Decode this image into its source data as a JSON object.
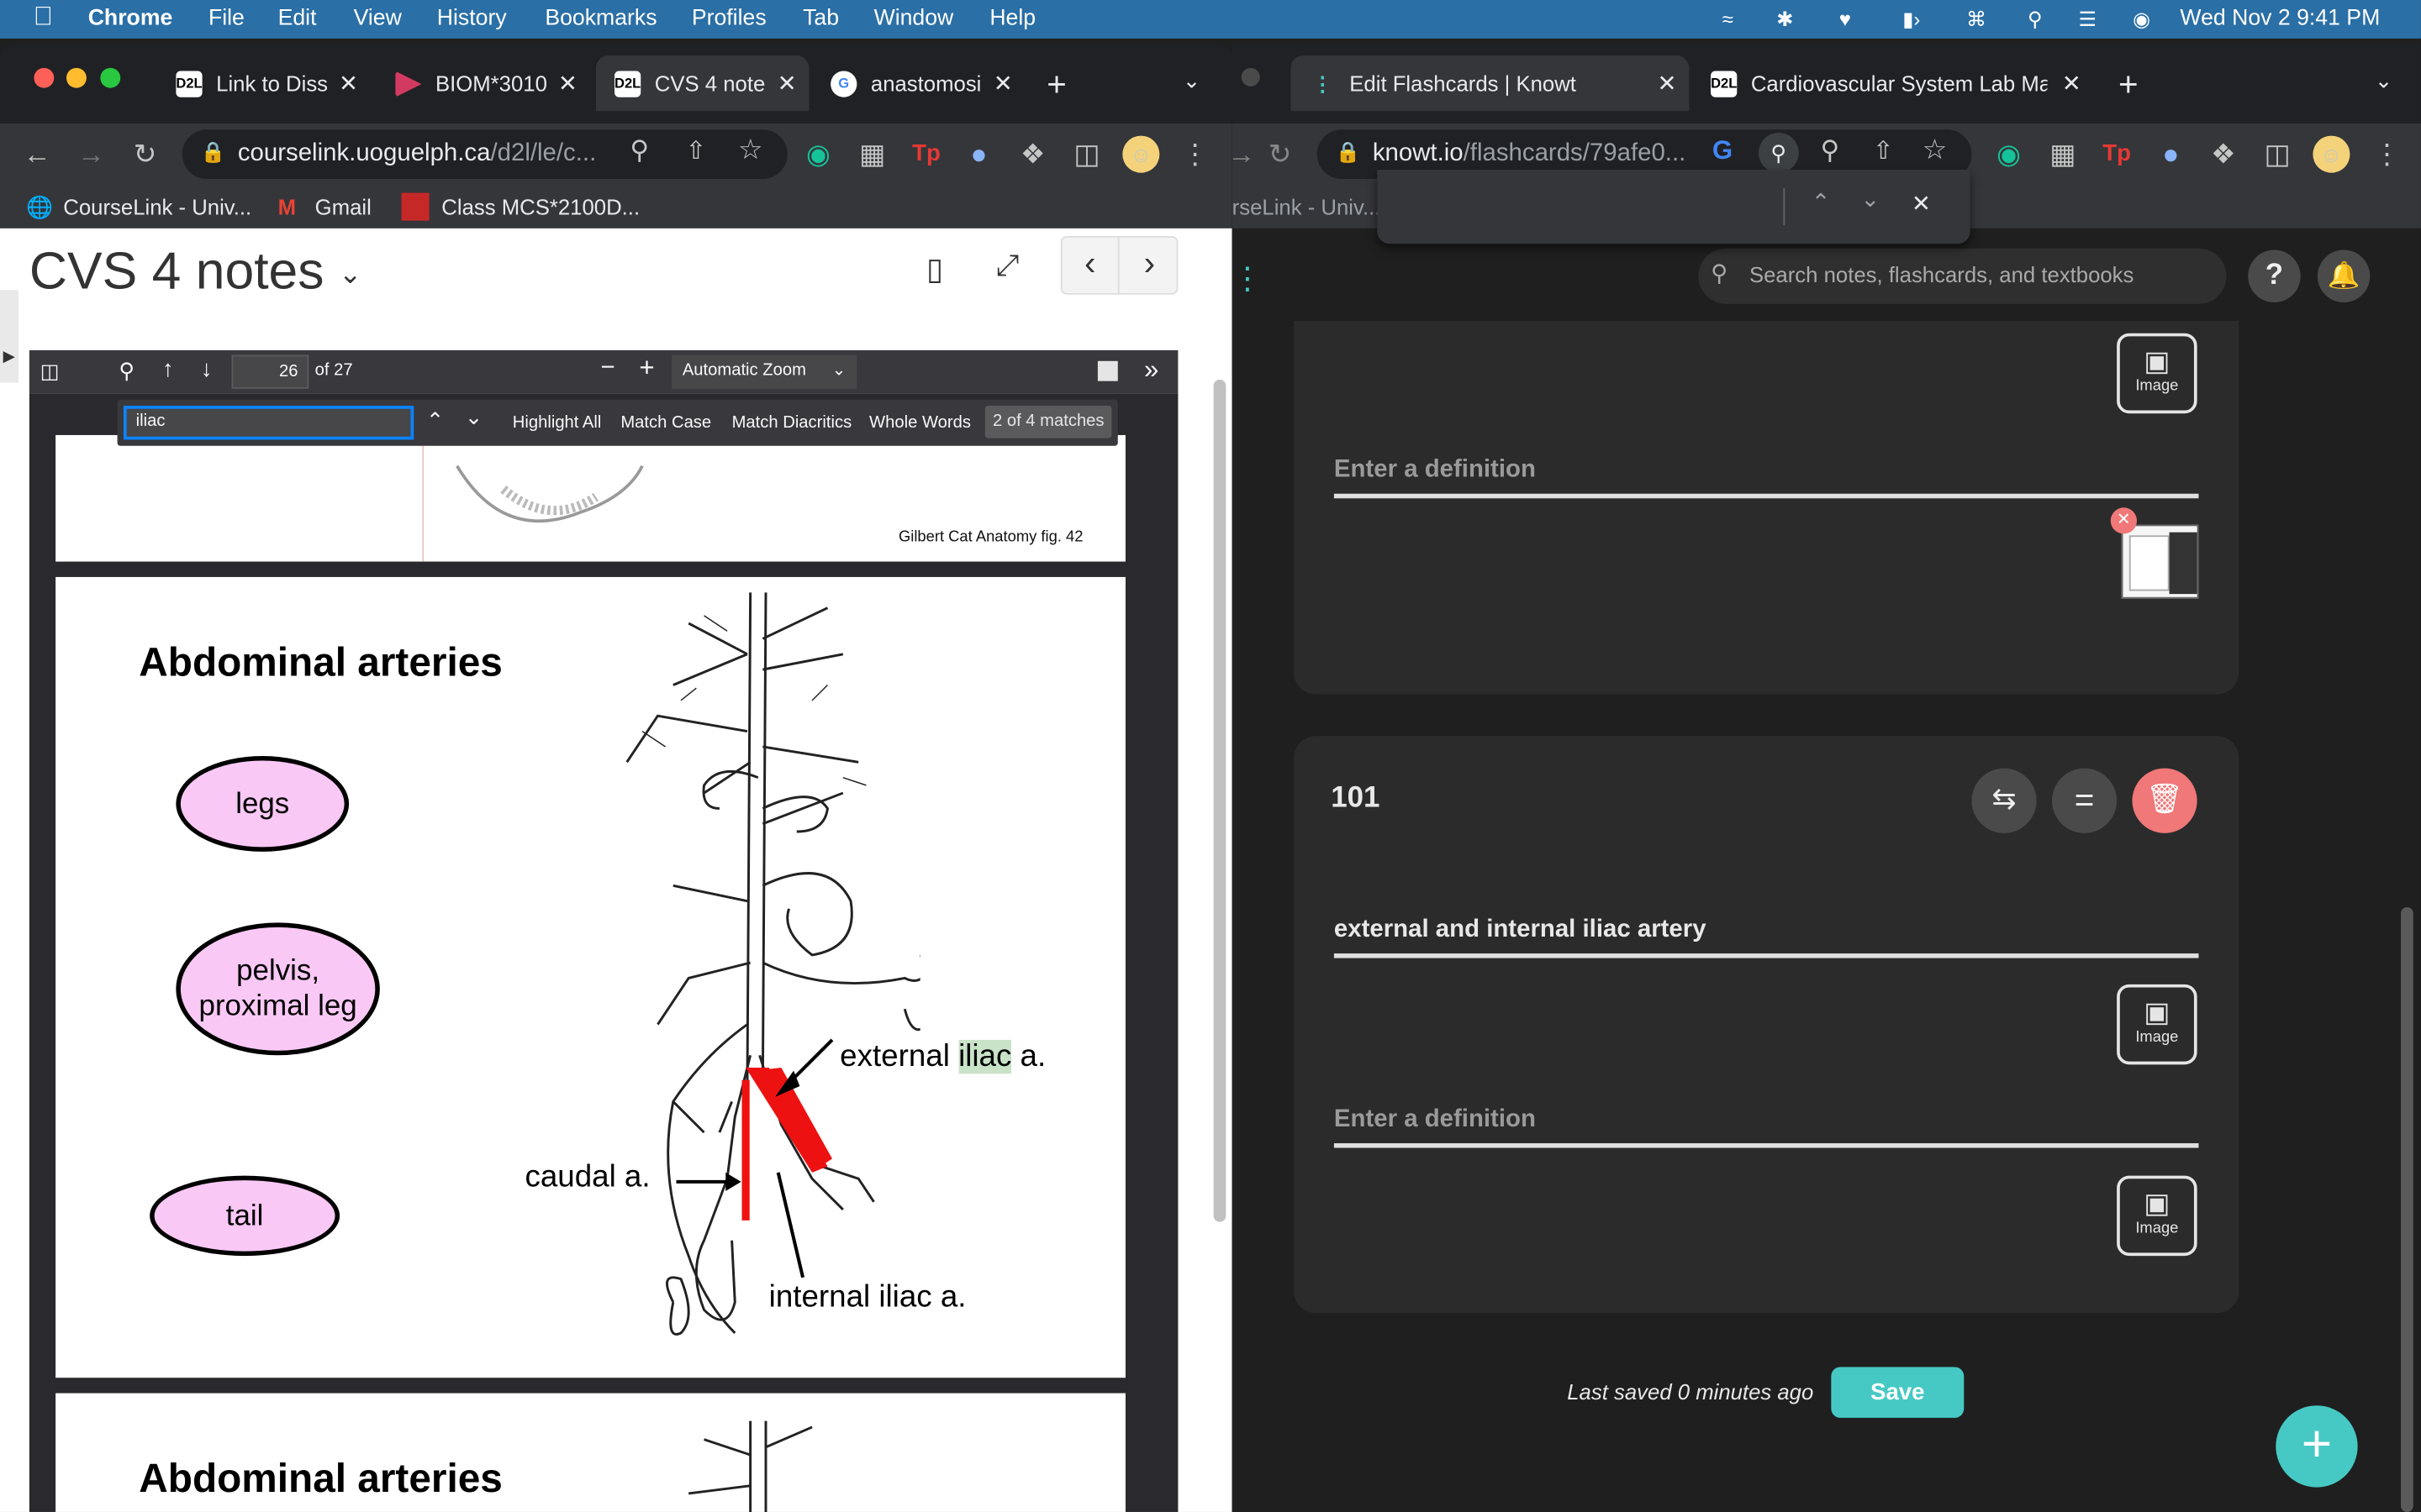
{
  "menubar": {
    "app": "Chrome",
    "items": [
      "File",
      "Edit",
      "View",
      "History",
      "Bookmarks",
      "Profiles",
      "Tab",
      "Window",
      "Help"
    ],
    "clock": "Wed Nov 2  9:41 PM"
  },
  "left_window": {
    "tabs": [
      {
        "label": "Link to Diss",
        "fav": "D2L"
      },
      {
        "label": "BIOM*3010",
        "fav": ""
      },
      {
        "label": "CVS 4 note",
        "fav": "D2L"
      },
      {
        "label": "anastomosi",
        "fav": "G"
      }
    ],
    "url_host": "courselink.uoguelph.ca",
    "url_path": "/d2l/le/c...",
    "bookmarks": [
      "CourseLink - Univ...",
      "Gmail",
      "Class MCS*2100D..."
    ],
    "doc_title": "CVS 4 notes",
    "pdf": {
      "page": "26",
      "of": "of 27",
      "zoom": "Automatic Zoom"
    },
    "find": {
      "query": "iliac",
      "highlight_all": "Highlight All",
      "match_case": "Match Case",
      "match_diacritics": "Match Diacritics",
      "whole_words": "Whole Words",
      "status": "2 of 4 matches"
    },
    "page_top_caption": "Gilbert Cat Anatomy fig. 42",
    "slide": {
      "title": "Abdominal arteries",
      "ovals": [
        "legs",
        "pelvis,\nproximal leg",
        "tail"
      ],
      "labels": {
        "external": "external ",
        "iliac": "iliac",
        "a": " a.",
        "caudal": "caudal a.",
        "internal": "internal iliac a."
      }
    },
    "slide2_title": "Abdominal arteries"
  },
  "right_window": {
    "tabs": [
      {
        "label": "Edit Flashcards | Knowt"
      },
      {
        "label": "Cardiovascular System Lab Ma",
        "fav": "D2L"
      }
    ],
    "url_host": "knowt.io",
    "url_path": "/flashcards/79afe0...",
    "bookmark_partial": "rseLink - Univ...",
    "search_placeholder": "Search notes, flashcards, and textbooks",
    "card_top": {
      "definition_placeholder": "Enter a definition",
      "image_label": "Image"
    },
    "card": {
      "number": "101",
      "term": "external and internal iliac artery",
      "definition_placeholder": "Enter a definition",
      "image_label": "Image"
    },
    "last_saved": "Last saved 0 minutes ago",
    "save": "Save"
  },
  "colors": {
    "accent": "#46c9c4",
    "delete": "#f07878",
    "menubar": "#2a6fa6"
  }
}
